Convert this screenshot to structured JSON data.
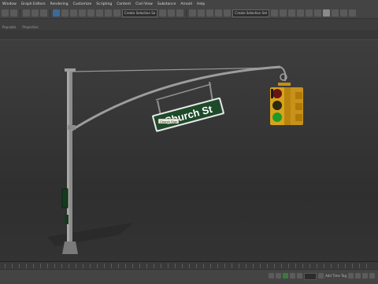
{
  "menu": [
    "Window",
    "Graph Editors",
    "Rendering",
    "Customize",
    "Scripting",
    "Content",
    "Civil View",
    "Substance",
    "Arnold",
    "Help"
  ],
  "toolbar": {
    "selection_set": "Create Selection Se",
    "snap_set": "Create Selection Set"
  },
  "ribbon": {
    "row2": [
      "Populate",
      "Properties"
    ]
  },
  "viewport": {
    "sign_text": "Church St",
    "tooltip_text": "Church Sign"
  },
  "status": {
    "frames_label": "Add Time Tag"
  },
  "colors": {
    "sign_green": "#1e4a2a",
    "signal_yellow": "#d9a31a",
    "pole_gray": "#9a9a9a"
  }
}
